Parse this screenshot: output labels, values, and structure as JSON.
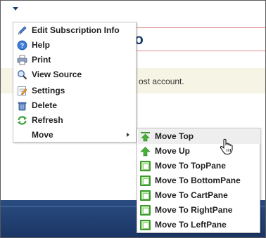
{
  "background": {
    "title_fragment": "o",
    "notice_fragment": "ost account."
  },
  "menu": {
    "items": [
      {
        "label": "Edit Subscription Info",
        "icon": "pencil-icon"
      },
      {
        "label": "Help",
        "icon": "help-icon"
      },
      {
        "label": "Print",
        "icon": "printer-icon"
      },
      {
        "label": "View Source",
        "icon": "magnifier-icon"
      },
      {
        "label": "Settings",
        "icon": "settings-icon"
      },
      {
        "label": "Delete",
        "icon": "delete-icon"
      },
      {
        "label": "Refresh",
        "icon": "refresh-icon"
      },
      {
        "label": "Move",
        "icon": "",
        "has_submenu": true
      }
    ]
  },
  "submenu": {
    "items": [
      {
        "label": "Move Top",
        "icon": "move-top-icon",
        "highlighted": true
      },
      {
        "label": "Move Up",
        "icon": "move-up-icon"
      },
      {
        "label": "Move To TopPane",
        "icon": "pane-icon"
      },
      {
        "label": "Move To BottomPane",
        "icon": "pane-icon"
      },
      {
        "label": "Move To CartPane",
        "icon": "pane-icon"
      },
      {
        "label": "Move To RightPane",
        "icon": "pane-icon"
      },
      {
        "label": "Move To LeftPane",
        "icon": "pane-icon"
      }
    ]
  },
  "colors": {
    "accent": "#1b3f6e",
    "menu_hover": "#eeeeee",
    "pane_icon_green": "#3c9a2e",
    "footer_band": "#1a3564"
  }
}
